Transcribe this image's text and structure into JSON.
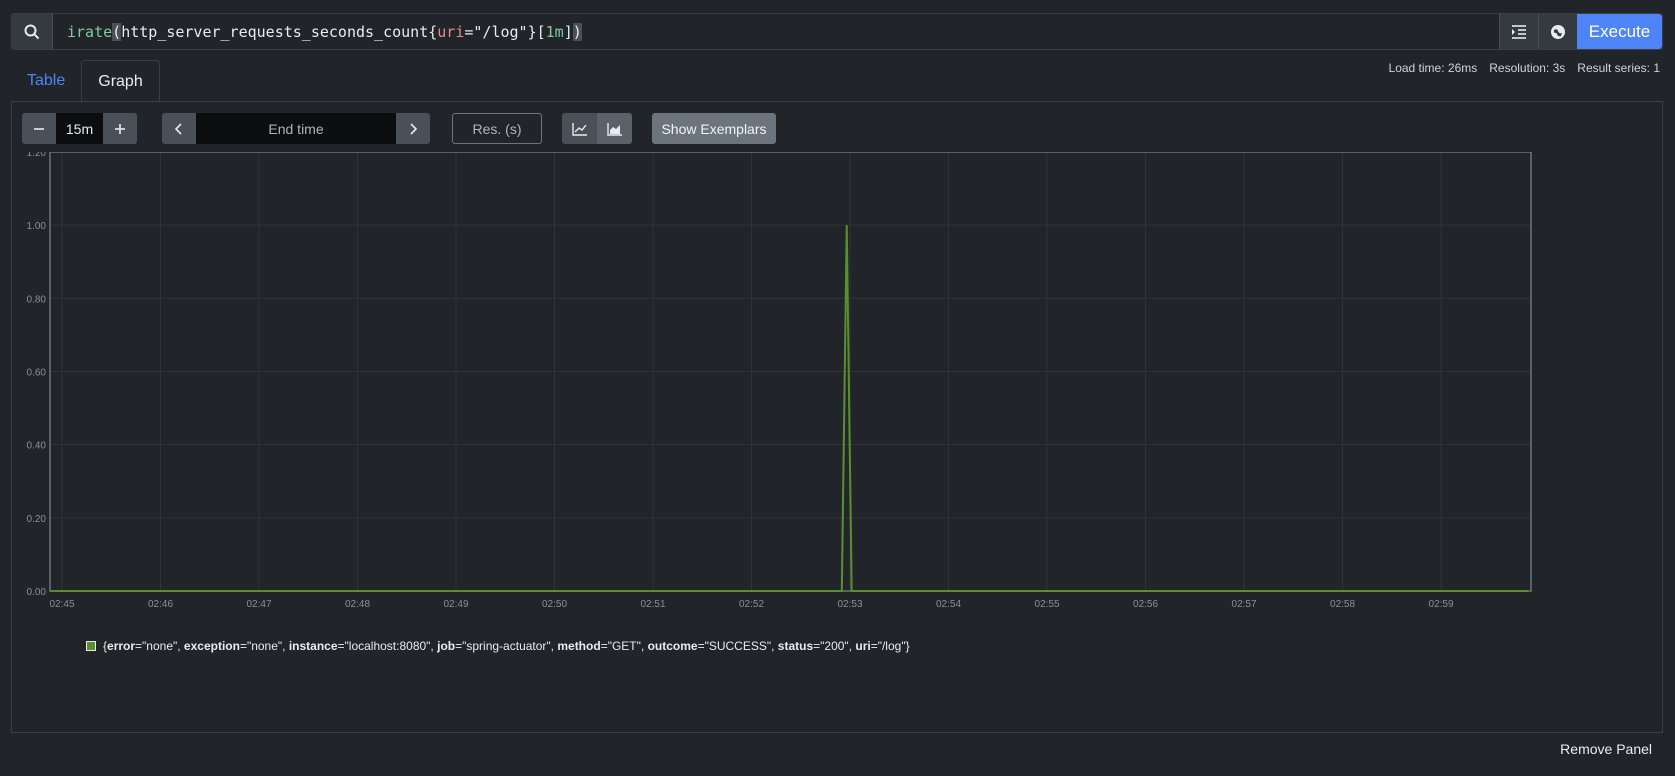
{
  "query": {
    "fn": "irate",
    "open_paren": "(",
    "metric": "http_server_requests_seconds_count",
    "brace_open": "{",
    "label_key": "uri",
    "eq": "=",
    "label_val": "\"/log\"",
    "brace_close": "}",
    "range_open": "[",
    "range": "1m",
    "range_close": "]",
    "close_paren": ")"
  },
  "toolbar": {
    "execute_label": "Execute"
  },
  "tabs": {
    "table": "Table",
    "graph": "Graph"
  },
  "stats": {
    "load_time": "Load time: 26ms",
    "resolution": "Resolution: 3s",
    "result_series": "Result series: 1"
  },
  "controls": {
    "range_value": "15m",
    "end_time_placeholder": "End time",
    "res_placeholder": "Res. (s)",
    "show_exemplars": "Show Exemplars"
  },
  "colors": {
    "series": "#5a8f2e",
    "accent": "#4e84f5"
  },
  "chart_data": {
    "type": "line",
    "y_ticks": [
      "0.00",
      "0.20",
      "0.40",
      "0.60",
      "0.80",
      "1.00",
      "1.20"
    ],
    "ylim": [
      0,
      1.2
    ],
    "x_ticks": [
      "02:45",
      "02:46",
      "02:47",
      "02:48",
      "02:49",
      "02:50",
      "02:51",
      "02:52",
      "02:53",
      "02:54",
      "02:55",
      "02:56",
      "02:57",
      "02:58",
      "02:59"
    ],
    "series": [
      {
        "x": [
          "02:44:53",
          "02:52:55",
          "02:52:58",
          "02:53:01",
          "02:59:53"
        ],
        "values": [
          0,
          0,
          1.0,
          0,
          0
        ]
      }
    ],
    "grid": true,
    "legend_position": "bottom-left"
  },
  "legend": {
    "open": "{",
    "items": [
      {
        "k": "error",
        "v": "\"none\""
      },
      {
        "k": "exception",
        "v": "\"none\""
      },
      {
        "k": "instance",
        "v": "\"localhost:8080\""
      },
      {
        "k": "job",
        "v": "\"spring-actuator\""
      },
      {
        "k": "method",
        "v": "\"GET\""
      },
      {
        "k": "outcome",
        "v": "\"SUCCESS\""
      },
      {
        "k": "status",
        "v": "\"200\""
      },
      {
        "k": "uri",
        "v": "\"/log\""
      }
    ],
    "close": "}"
  },
  "footer": {
    "remove_panel": "Remove Panel"
  }
}
